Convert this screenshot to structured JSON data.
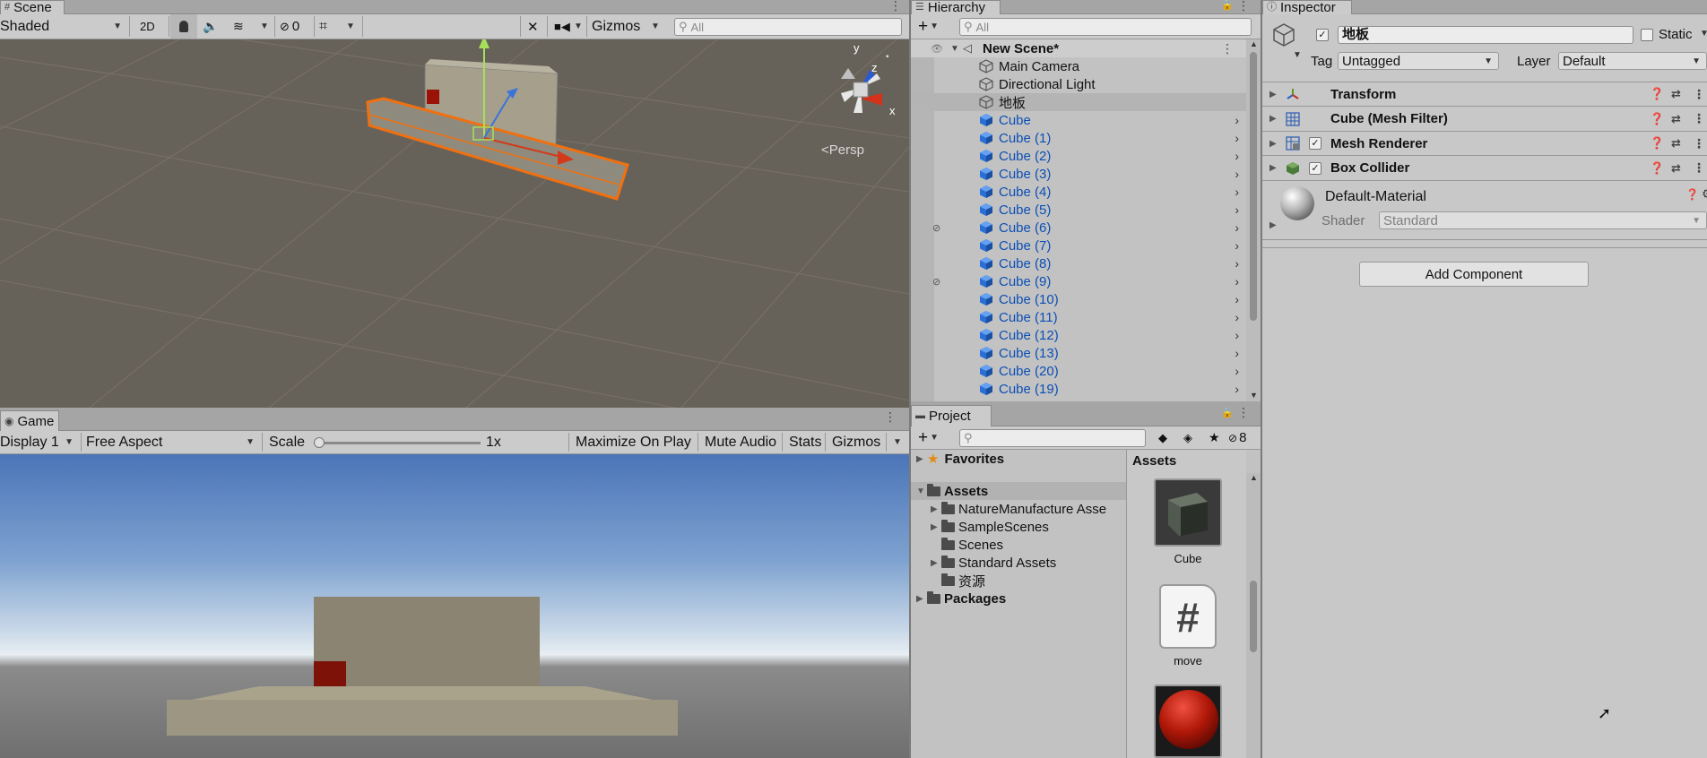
{
  "scene": {
    "tab_label": "Scene",
    "shading_mode": "Shaded",
    "btn_2d": "2D",
    "hidden_count": "0",
    "gizmos_label": "Gizmos",
    "search_placeholder": "All",
    "persp_label": "Persp",
    "axis_y": "y",
    "axis_z": "z",
    "axis_x": "x"
  },
  "game": {
    "tab_label": "Game",
    "display": "Display 1",
    "aspect": "Free Aspect",
    "scale_label": "Scale",
    "scale_value": "1x",
    "maximize_label": "Maximize On Play",
    "mute_label": "Mute Audio",
    "stats_label": "Stats",
    "gizmos_label": "Gizmos"
  },
  "hierarchy": {
    "tab_label": "Hierarchy",
    "search_placeholder": "All",
    "scene_name": "New Scene*",
    "items": [
      {
        "label": "Main Camera",
        "type": "gameobject"
      },
      {
        "label": "Directional Light",
        "type": "gameobject"
      },
      {
        "label": "地板",
        "type": "gameobject",
        "selected": true
      },
      {
        "label": "Cube",
        "type": "prefab"
      },
      {
        "label": "Cube (1)",
        "type": "prefab"
      },
      {
        "label": "Cube (2)",
        "type": "prefab"
      },
      {
        "label": "Cube (3)",
        "type": "prefab"
      },
      {
        "label": "Cube (4)",
        "type": "prefab"
      },
      {
        "label": "Cube (5)",
        "type": "prefab"
      },
      {
        "label": "Cube (6)",
        "type": "prefab",
        "hidden": true
      },
      {
        "label": "Cube (7)",
        "type": "prefab"
      },
      {
        "label": "Cube (8)",
        "type": "prefab"
      },
      {
        "label": "Cube (9)",
        "type": "prefab",
        "hidden": true
      },
      {
        "label": "Cube (10)",
        "type": "prefab"
      },
      {
        "label": "Cube (11)",
        "type": "prefab"
      },
      {
        "label": "Cube (12)",
        "type": "prefab"
      },
      {
        "label": "Cube (13)",
        "type": "prefab"
      },
      {
        "label": "Cube (20)",
        "type": "prefab"
      },
      {
        "label": "Cube (19)",
        "type": "prefab"
      }
    ]
  },
  "project": {
    "tab_label": "Project",
    "hidden_count": "8",
    "favorites_label": "Favorites",
    "assets_label": "Assets",
    "folders": [
      "NatureManufacture Asse",
      "SampleScenes",
      "Scenes",
      "Standard Assets",
      "资源"
    ],
    "packages_label": "Packages",
    "assets_header": "Assets",
    "asset_items": [
      "Cube",
      "move"
    ]
  },
  "inspector": {
    "tab_label": "Inspector",
    "object_name": "地板",
    "static_label": "Static",
    "tag_label": "Tag",
    "tag_value": "Untagged",
    "layer_label": "Layer",
    "layer_value": "Default",
    "components": [
      {
        "label": "Transform",
        "has_checkbox": false
      },
      {
        "label": "Cube (Mesh Filter)",
        "has_checkbox": false
      },
      {
        "label": "Mesh Renderer",
        "has_checkbox": true
      },
      {
        "label": "Box Collider",
        "has_checkbox": true
      }
    ],
    "material_name": "Default-Material",
    "shader_label": "Shader",
    "shader_value": "Standard",
    "add_component_label": "Add Component"
  },
  "colors": {
    "prefab_blue": "#0b4fb5",
    "selection_orange": "#f07010",
    "panel_bg": "#c8c8c8"
  }
}
